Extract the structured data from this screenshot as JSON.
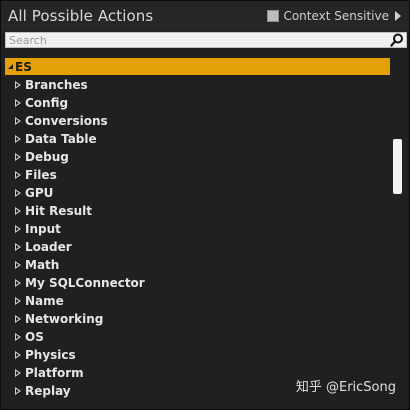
{
  "header": {
    "title": "All Possible Actions",
    "context_sensitive_label": "Context Sensitive"
  },
  "search": {
    "placeholder": "Search",
    "value": ""
  },
  "tree": {
    "root_label": "ES",
    "items": [
      {
        "label": "Branches"
      },
      {
        "label": "Config"
      },
      {
        "label": "Conversions"
      },
      {
        "label": "Data Table"
      },
      {
        "label": "Debug"
      },
      {
        "label": "Files"
      },
      {
        "label": "GPU"
      },
      {
        "label": "Hit Result"
      },
      {
        "label": "Input"
      },
      {
        "label": "Loader"
      },
      {
        "label": "Math"
      },
      {
        "label": "My SQLConnector"
      },
      {
        "label": "Name"
      },
      {
        "label": "Networking"
      },
      {
        "label": "OS"
      },
      {
        "label": "Physics"
      },
      {
        "label": "Platform"
      },
      {
        "label": "Replay"
      }
    ]
  },
  "watermark": "知乎 @EricSong",
  "colors": {
    "selected_row": "#e3a008",
    "background": "#202020",
    "text": "#e6e6e6"
  }
}
